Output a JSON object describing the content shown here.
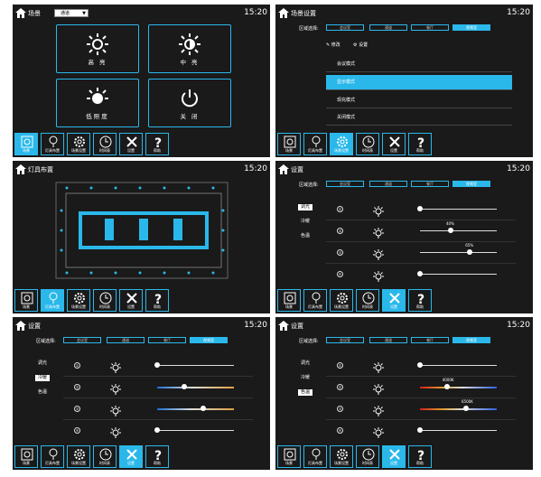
{
  "time": "15:20",
  "panel_scene": {
    "title": "场景",
    "dropdown_value": "通道",
    "tiles": [
      {
        "label": "高 亮",
        "icon": "sun-icon"
      },
      {
        "label": "中 亮",
        "icon": "half-sun-icon"
      },
      {
        "label": "低照度",
        "icon": "sun-dim-icon"
      },
      {
        "label": "关 闭",
        "icon": "power-icon"
      }
    ]
  },
  "panel_scene_setting": {
    "title": "场景设置",
    "zone_label": "区域选择:",
    "zones": [
      "会议室",
      "通道",
      "餐厅",
      "视频室"
    ],
    "edit_label": "修改",
    "setting_label": "设置",
    "modes": [
      "会议模式",
      "显示模式",
      "现充模式",
      "关闭模式"
    ]
  },
  "panel_fixtures": {
    "title": "灯具布置"
  },
  "panel_settings": {
    "title": "设置",
    "zone_label": "区域选择:",
    "zones": [
      "会议室",
      "通道",
      "餐厅",
      "视频室"
    ],
    "side": [
      "调光",
      "冷暖",
      "色温"
    ],
    "rows": [
      "①",
      "②",
      "③",
      "④"
    ],
    "dim_values": [
      {
        "pct": 0
      },
      {
        "pct": 40,
        "label": "40%"
      },
      {
        "pct": 65,
        "label": "65%"
      },
      {
        "pct": 0
      }
    ],
    "cct_values": [
      {
        "pct": 0
      },
      {
        "pct": 35,
        "label": "4000K"
      },
      {
        "pct": 60,
        "label": "6500K"
      },
      {
        "pct": 0
      }
    ]
  },
  "nav": [
    {
      "label": "场景",
      "icon": "scene-icon"
    },
    {
      "label": "灯具布置",
      "icon": "bulb-icon"
    },
    {
      "label": "场景设置",
      "icon": "gear-icon"
    },
    {
      "label": "时间表",
      "icon": "clock-icon"
    },
    {
      "label": "设置",
      "icon": "tools-icon"
    },
    {
      "label": "帮助",
      "icon": "help-icon"
    }
  ],
  "colors": {
    "accent": "#2ab8ea",
    "bg": "#1a1a1a"
  }
}
